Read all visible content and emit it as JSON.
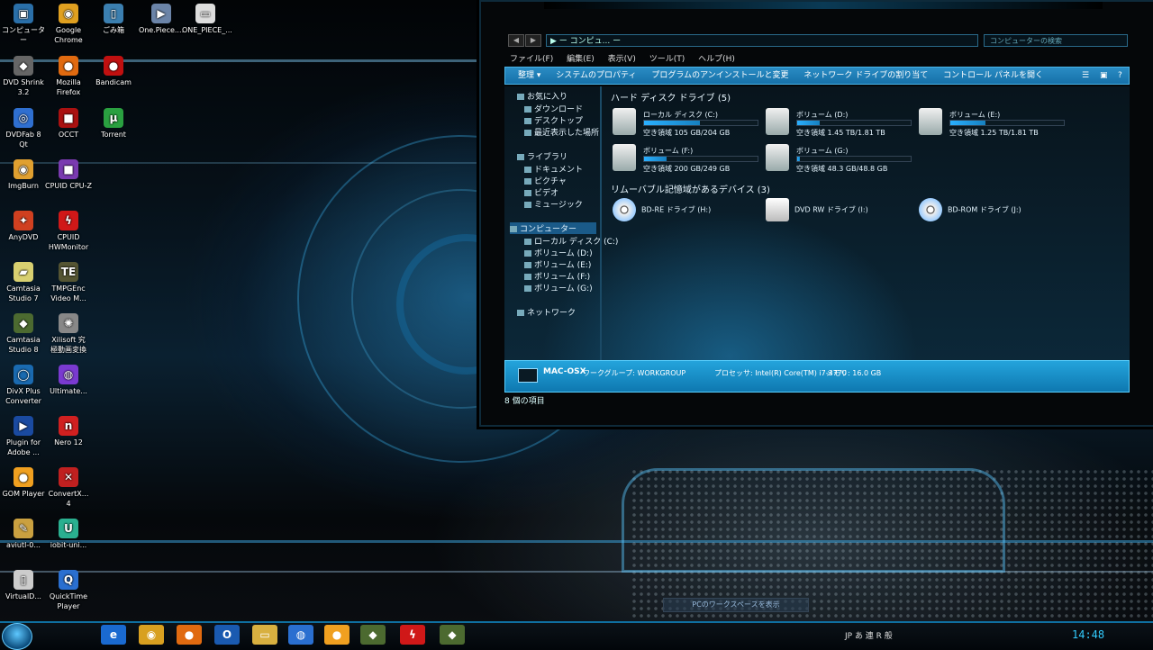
{
  "desktop": {
    "icons": [
      {
        "label": "コンピューター",
        "color": "#2a6fa8",
        "glyph": "▣"
      },
      {
        "label": "Google\nChrome",
        "color": "#e0a020",
        "glyph": "◉"
      },
      {
        "label": "ごみ箱",
        "color": "#3b7fb0",
        "glyph": "▯"
      },
      {
        "label": "One.Piece....",
        "color": "#6b84a8",
        "glyph": "▶"
      },
      {
        "label": "ONE_PIECE_...",
        "color": "#ddd",
        "glyph": "▭"
      },
      {
        "label": "DVD Shrink\n3.2",
        "color": "#666",
        "glyph": "◆"
      },
      {
        "label": "Mozilla\nFirefox",
        "color": "#e06a10",
        "glyph": "●"
      },
      {
        "label": "Bandicam",
        "color": "#c01010",
        "glyph": "●"
      },
      {
        "label": "DVDFab 8\nQt",
        "color": "#2f6fd0",
        "glyph": "◎"
      },
      {
        "label": "OCCT",
        "color": "#aa1111",
        "glyph": "■"
      },
      {
        "label": "Torrent",
        "color": "#2aa040",
        "glyph": "μ"
      },
      {
        "label": "ImgBurn",
        "color": "#e0a030",
        "glyph": "◉"
      },
      {
        "label": "CPUID CPU-Z",
        "color": "#7a3ab0",
        "glyph": "■"
      },
      {
        "label": "AnyDVD",
        "color": "#d04020",
        "glyph": "✦"
      },
      {
        "label": "CPUID\nHWMonitor",
        "color": "#d01818",
        "glyph": "ϟ"
      },
      {
        "label": "Camtasia\nStudio 7",
        "color": "#d8d070",
        "glyph": "▰"
      },
      {
        "label": "TMPGEnc\nVideo M...",
        "color": "#553",
        "glyph": "TE"
      },
      {
        "label": "Camtasia\nStudio 8",
        "color": "#4c6a30",
        "glyph": "◆"
      },
      {
        "label": "Xilisoft 究\n極動画変換",
        "color": "#888",
        "glyph": "✺"
      },
      {
        "label": "DivX Plus\nConverter",
        "color": "#1a6ab0",
        "glyph": "◯"
      },
      {
        "label": "Ultimate...",
        "color": "#7a3ad0",
        "glyph": "◍"
      },
      {
        "label": "Plugin for\nAdobe ...",
        "color": "#1a4aa0",
        "glyph": "▶"
      },
      {
        "label": "Nero 12",
        "color": "#d02020",
        "glyph": "n"
      },
      {
        "label": "GOM Player",
        "color": "#f0a020",
        "glyph": "●"
      },
      {
        "label": "ConvertX...\n4",
        "color": "#c02020",
        "glyph": "✕"
      },
      {
        "label": "aviutl-0...",
        "color": "#caa040",
        "glyph": "✎"
      },
      {
        "label": "iobit-uni...",
        "color": "#2ab090",
        "glyph": "U"
      },
      {
        "label": "VirtualD...",
        "color": "#ccc",
        "glyph": "▯"
      },
      {
        "label": "QuickTime\nPlayer",
        "color": "#2a6fd0",
        "glyph": "Q"
      }
    ]
  },
  "explorer": {
    "nav_back": "◀",
    "nav_forward": "▶",
    "address": "▶ ー コンピュ... ー",
    "search_placeholder": "コンピューターの検索",
    "menu": [
      "ファイル(F)",
      "編集(E)",
      "表示(V)",
      "ツール(T)",
      "ヘルプ(H)"
    ],
    "commands": [
      "整理 ▾",
      "システムのプロパティ",
      "プログラムのアンインストールと変更",
      "ネットワーク ドライブの割り当て",
      "コントロール パネルを開く"
    ],
    "navpane": {
      "favorites": "お気に入り",
      "favorite_items": [
        "ダウンロード",
        "デスクトップ",
        "最近表示した場所"
      ],
      "libraries": "ライブラリ",
      "library_items": [
        "ドキュメント",
        "ピクチャ",
        "ビデオ",
        "ミュージック"
      ],
      "computer": "コンピューター",
      "computer_items": [
        "ローカル ディスク (C:)",
        "ボリューム (D:)",
        "ボリューム (E:)",
        "ボリューム (F:)",
        "ボリューム (G:)"
      ],
      "network": "ネットワーク"
    },
    "hdd_section": "ハード ディスク ドライブ (5)",
    "drives": [
      {
        "name": "ローカル ディスク (C:)",
        "free": "空き領域 105 GB/204 GB",
        "used": 0.49
      },
      {
        "name": "ボリューム (D:)",
        "free": "空き領域 1.45 TB/1.81 TB",
        "used": 0.2
      },
      {
        "name": "ボリューム (E:)",
        "free": "空き領域 1.25 TB/1.81 TB",
        "used": 0.31
      },
      {
        "name": "ボリューム (F:)",
        "free": "空き領域 200 GB/249 GB",
        "used": 0.2
      },
      {
        "name": "ボリューム (G:)",
        "free": "空き領域 48.3 GB/48.8 GB",
        "used": 0.01
      }
    ],
    "removable_section": "リムーバブル記憶域があるデバイス (3)",
    "discs": [
      "BD-RE ドライブ (H:)",
      "DVD RW ドライブ (I:)",
      "BD-ROM ドライブ (J:)"
    ],
    "details": {
      "name": "MAC-OSX",
      "workgroup": "ワークグループ: WORKGROUP",
      "memory": "メモリ: 16.0 GB",
      "processor": "プロセッサ: Intel(R) Core(TM) i7-3770"
    },
    "status": "8 個の項目"
  },
  "taskbar": {
    "apps": [
      {
        "glyph": "e",
        "color": "#1a6ad0"
      },
      {
        "glyph": "◉",
        "color": "#d8a020"
      },
      {
        "glyph": "●",
        "color": "#e06a10"
      },
      {
        "glyph": "O",
        "color": "#1a5ab0"
      },
      {
        "glyph": "▭",
        "color": "#d8b040"
      },
      {
        "glyph": "◍",
        "color": "#2a6fd0"
      },
      {
        "glyph": "●",
        "color": "#f0a020"
      },
      {
        "glyph": "◆",
        "color": "#4c6a30"
      },
      {
        "glyph": "ϟ",
        "color": "#d01818"
      },
      {
        "glyph": "◆",
        "color": "#4c6a30"
      }
    ],
    "tray_text": "JP  あ 連 R 般",
    "clock": "14:48",
    "tooltip": "PCのワークスペースを表示"
  }
}
